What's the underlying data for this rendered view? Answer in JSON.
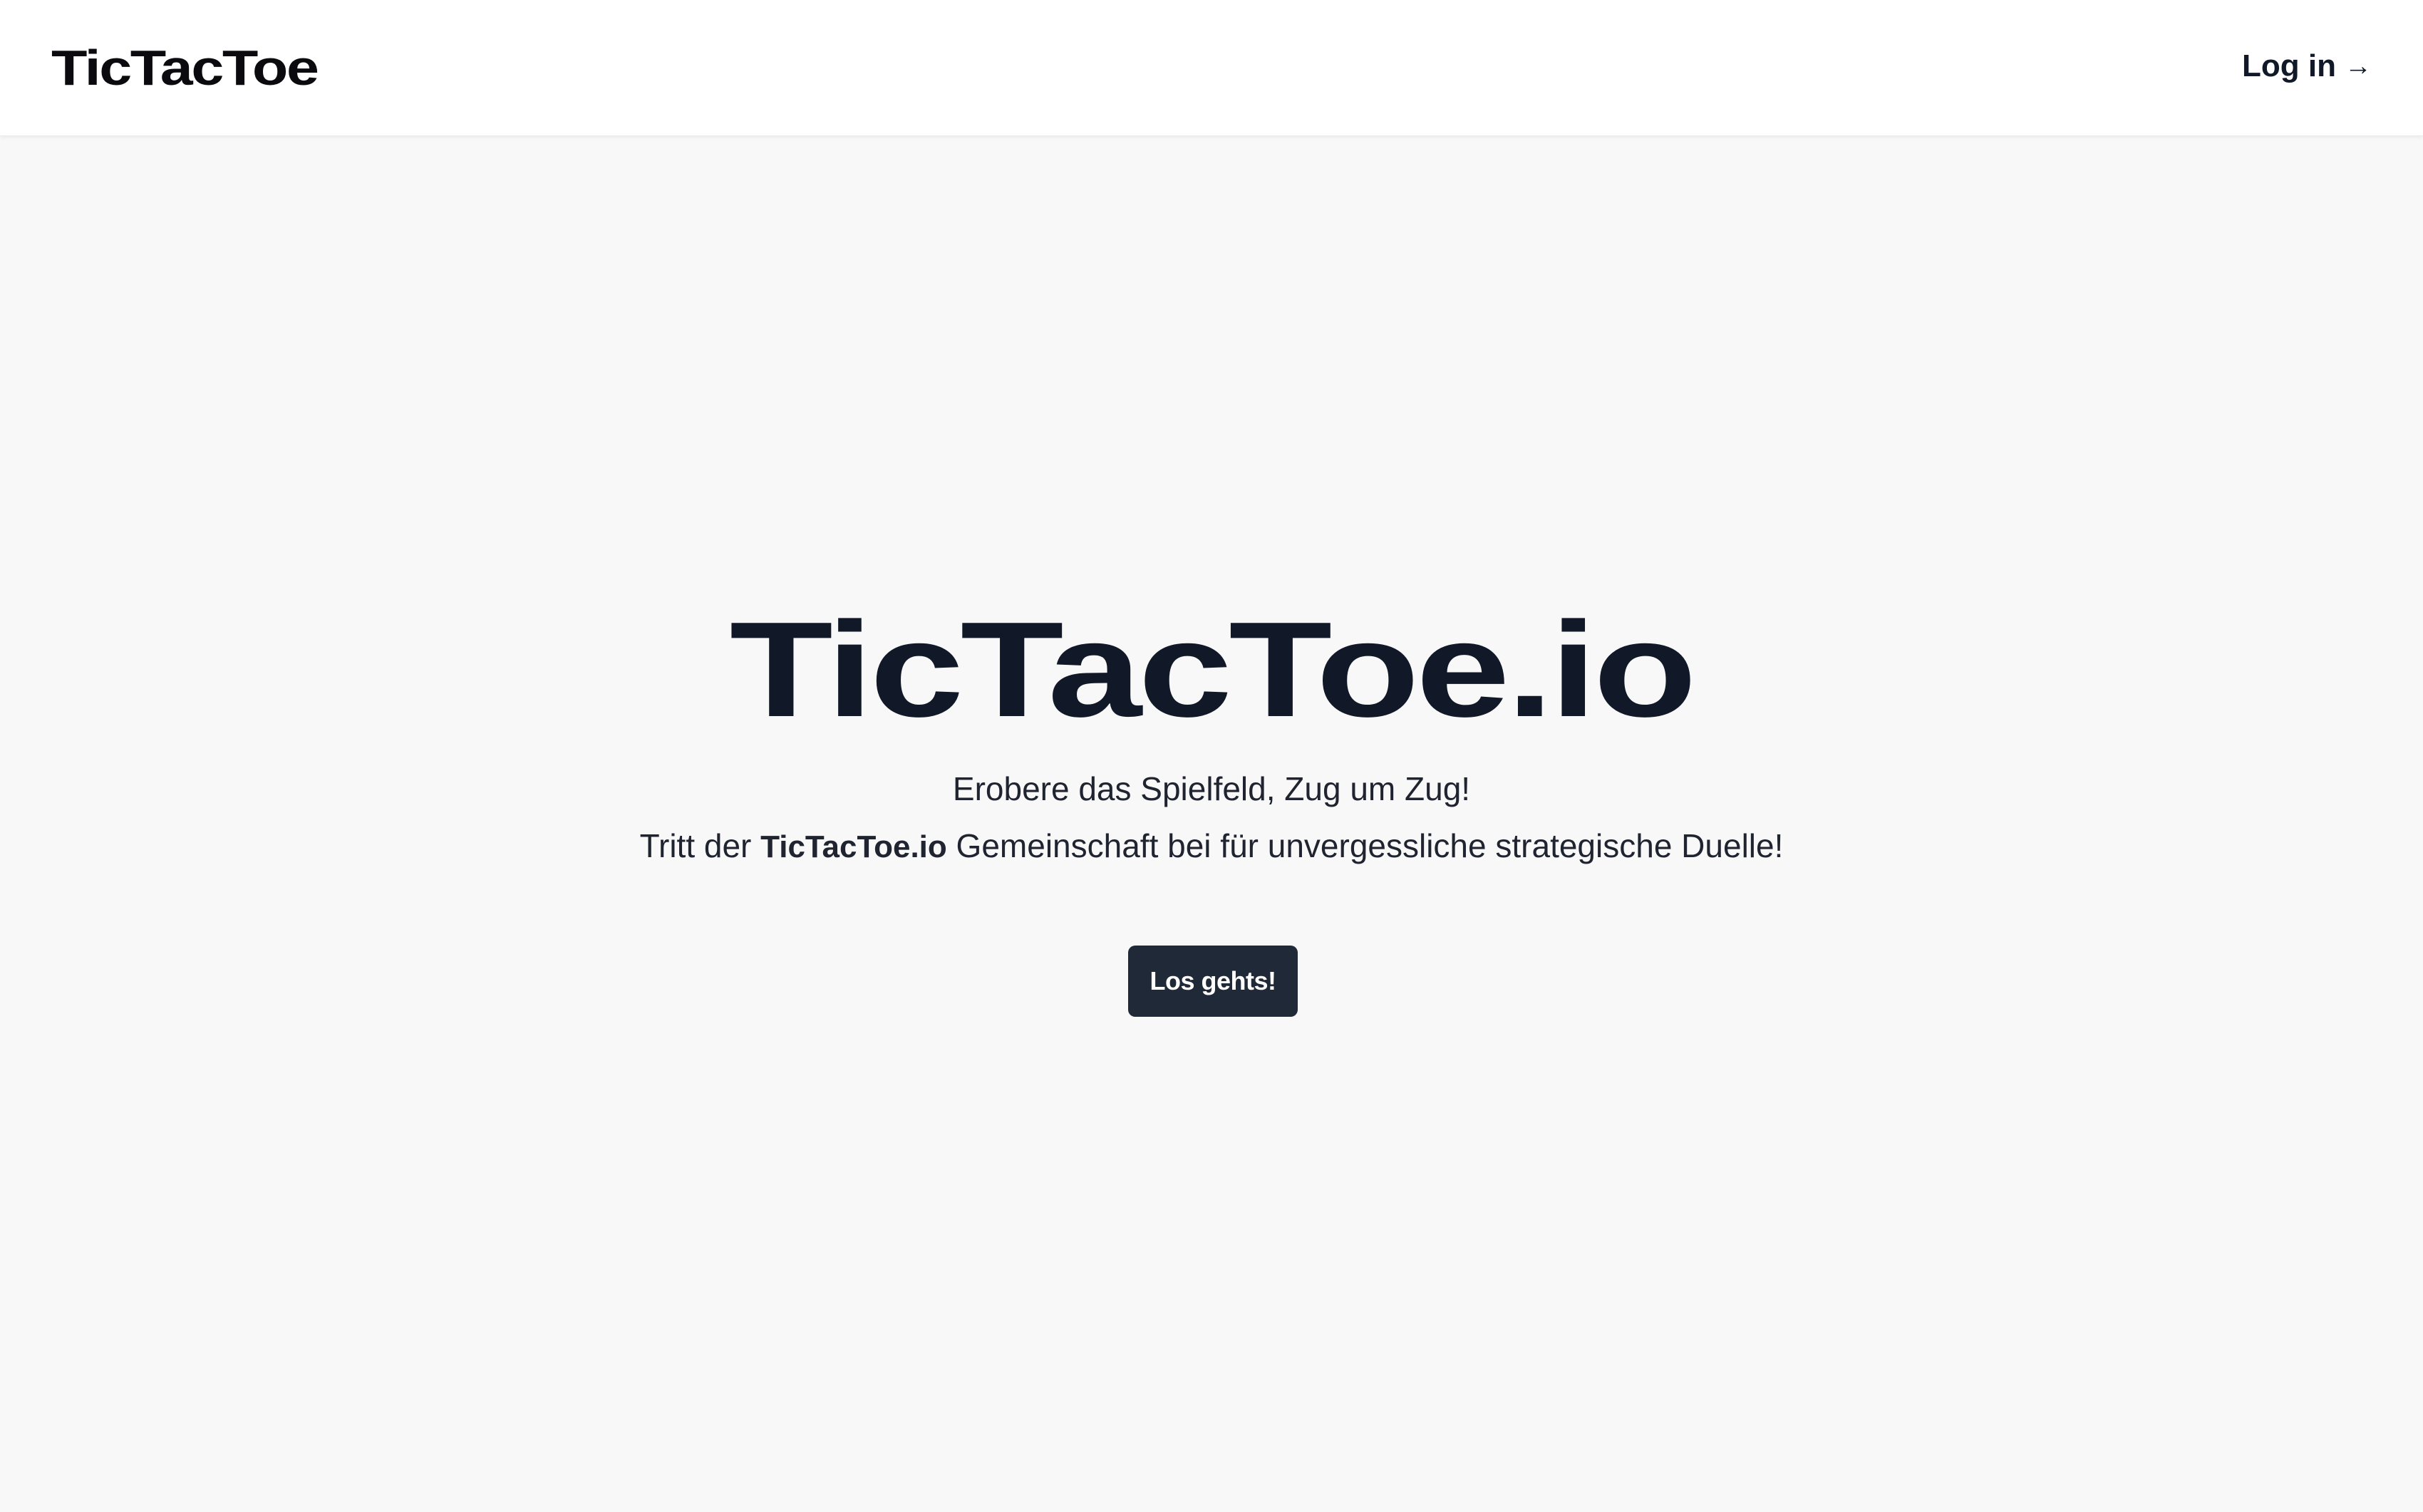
{
  "navbar": {
    "brand": "TicTacToe",
    "login_label": "Log in",
    "login_arrow": "→"
  },
  "hero": {
    "title": "TicTacToe.io",
    "tagline_line1": "Erobere das Spielfeld, Zug um Zug!",
    "tagline_line2_prefix": "Tritt der ",
    "tagline_line2_brand": "TicTacToe.io",
    "tagline_line2_suffix": " Gemeinschaft bei für unvergessliche strategische Duelle!",
    "cta_label": "Los gehts!"
  },
  "colors": {
    "background": "#f8f8f8",
    "navbar_bg": "#ffffff",
    "text_dark": "#111827",
    "button_bg": "#1f2937",
    "button_text": "#ffffff"
  },
  "icons": {
    "login_icon": "arrow-right-icon"
  }
}
